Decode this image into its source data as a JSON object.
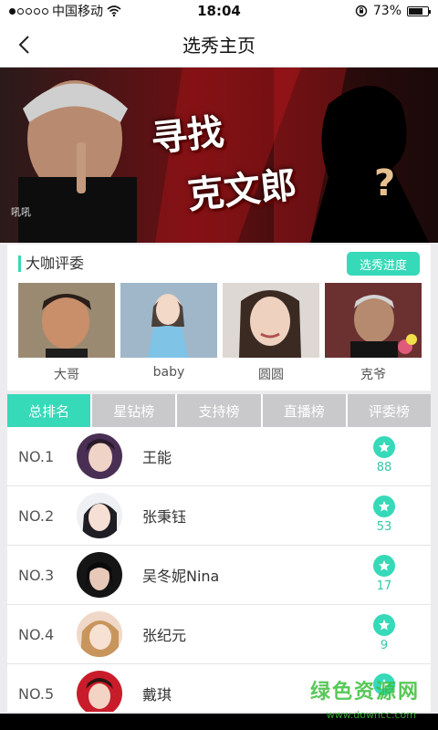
{
  "status": {
    "carrier": "中国移动",
    "time": "18:04",
    "battery": "73%",
    "battery_level": 0.73
  },
  "nav": {
    "title": "选秀主页",
    "back_icon": "chevron-left-icon"
  },
  "banner": {
    "title_line1": "寻找",
    "title_line2": "克文郎",
    "caption": "吼吼"
  },
  "judges": {
    "title": "大咖评委",
    "progress_button": "选秀进度",
    "items": [
      {
        "name": "大哥"
      },
      {
        "name": "baby"
      },
      {
        "name": "圆圆"
      },
      {
        "name": "克爷"
      }
    ]
  },
  "tabs": [
    {
      "label": "总排名",
      "active": true
    },
    {
      "label": "星钻榜",
      "active": false
    },
    {
      "label": "支持榜",
      "active": false
    },
    {
      "label": "直播榜",
      "active": false
    },
    {
      "label": "评委榜",
      "active": false
    }
  ],
  "ranking": [
    {
      "rank": "NO.1",
      "name": "王能",
      "score": "88"
    },
    {
      "rank": "NO.2",
      "name": "张秉钰",
      "score": "53"
    },
    {
      "rank": "NO.3",
      "name": "吴冬妮Nina",
      "score": "17"
    },
    {
      "rank": "NO.4",
      "name": "张纪元",
      "score": "9"
    },
    {
      "rank": "NO.5",
      "name": "戴琪",
      "score": ""
    }
  ],
  "watermark": {
    "main": "绿色资源网",
    "sub": "www.downcc.com"
  },
  "colors": {
    "accent": "#36d9b8",
    "tab_inactive": "#c9c9cb"
  }
}
